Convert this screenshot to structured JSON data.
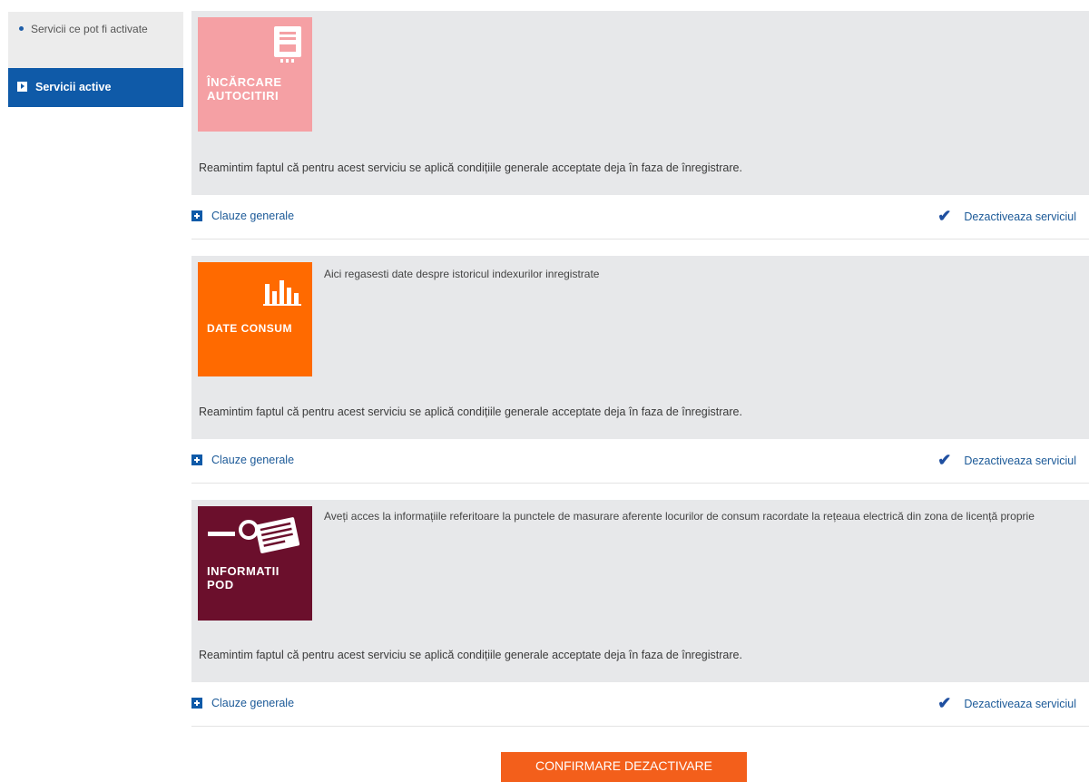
{
  "sidebar": {
    "items": [
      {
        "label": "Servicii ce pot fi activate",
        "active": false
      },
      {
        "label": "Servicii active",
        "active": true
      }
    ]
  },
  "services": [
    {
      "tile_label_line1": "ÎNCĂRCARE",
      "tile_label_line2": "AUTOCITIRI",
      "tile_icon": "meter-icon",
      "tile_color": "#f5a0a4",
      "description": "",
      "reminder": "Reamintim faptul că pentru acest serviciu se aplică condițiile generale acceptate deja în faza de înregistrare.",
      "clauses_link": "Clauze generale",
      "deactivate_label": "Dezactiveaza serviciul",
      "deactivate_checked": true
    },
    {
      "tile_label_line1": "DATE CONSUM",
      "tile_label_line2": "",
      "tile_icon": "bar-chart-icon",
      "tile_color": "#ff6a00",
      "description": "Aici regasesti date despre istoricul indexurilor inregistrate",
      "reminder": "Reamintim faptul că pentru acest serviciu se aplică condițiile generale acceptate deja în faza de înregistrare.",
      "clauses_link": "Clauze generale",
      "deactivate_label": "Dezactiveaza serviciul",
      "deactivate_checked": true
    },
    {
      "tile_label_line1": "INFORMATII",
      "tile_label_line2": "POD",
      "tile_icon": "document-search-icon",
      "tile_color": "#6b0f2c",
      "description": "Aveți acces la informațiile referitoare la punctele de masurare aferente locurilor de consum racordate la rețeaua electrică din zona de licență proprie",
      "reminder": "Reamintim faptul că pentru acest serviciu se aplică condițiile generale acceptate deja în faza de înregistrare.",
      "clauses_link": "Clauze generale",
      "deactivate_label": "Dezactiveaza serviciul",
      "deactivate_checked": true
    }
  ],
  "confirm_button": "CONFIRMARE DEZACTIVARE",
  "colors": {
    "primary_blue": "#0f5aa8",
    "link_blue": "#1c5a98",
    "confirm_orange": "#f35f1b"
  }
}
